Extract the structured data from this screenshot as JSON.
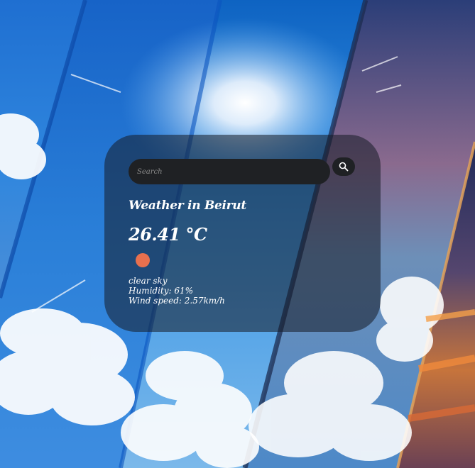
{
  "search": {
    "placeholder": "Search",
    "icon": "search-icon"
  },
  "weather": {
    "title": "Weather in Beirut",
    "temperature": "26.41 °C",
    "icon": "weather-icon",
    "icon_color": "#e8704e",
    "description": "clear sky",
    "humidity": "Humidity: 61%",
    "wind": "Wind speed: 2.57km/h"
  },
  "colors": {
    "card_background": "rgba(22, 28, 38, 0.55)",
    "input_background": "#1f2124",
    "text": "#ffffff"
  }
}
